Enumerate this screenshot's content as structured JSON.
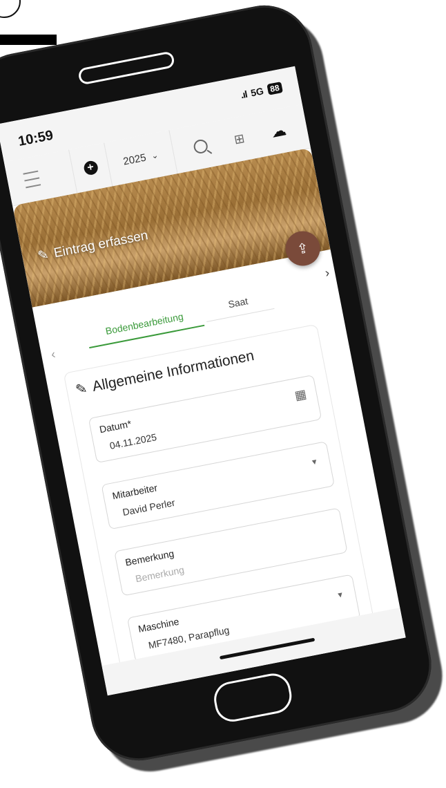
{
  "status": {
    "time": "10:59",
    "network": "5G",
    "battery": "88"
  },
  "toolbar": {
    "year": "2025",
    "year_chevron": "⌄"
  },
  "hero": {
    "title": "Eintrag erfassen"
  },
  "tabs": {
    "active": "Bodenbearbeitung",
    "inactive": "Saat"
  },
  "form": {
    "section_title": "Allgemeine Informationen",
    "fields": [
      {
        "label": "Datum*",
        "value": "04.11.2025",
        "placeholder": ""
      },
      {
        "label": "Mitarbeiter",
        "value": "David Perler",
        "placeholder": ""
      },
      {
        "label": "Bemerkung",
        "value": "",
        "placeholder": "Bemerkung"
      },
      {
        "label": "Maschine",
        "value": "MF7480, Parapflug",
        "placeholder": ""
      }
    ]
  },
  "icons": {
    "menu": "menu-icon",
    "add": "plus-circle-icon",
    "search": "search-icon",
    "apps": "apps-add-icon",
    "cloud": "cloud-lightning-icon",
    "upload": "upload-icon",
    "edit": "edit-icon",
    "calendar": "calendar-icon",
    "dropdown": "caret-down-icon"
  },
  "colors": {
    "tab_active": "#3a9a3a",
    "fab": "#7a4a3a"
  }
}
